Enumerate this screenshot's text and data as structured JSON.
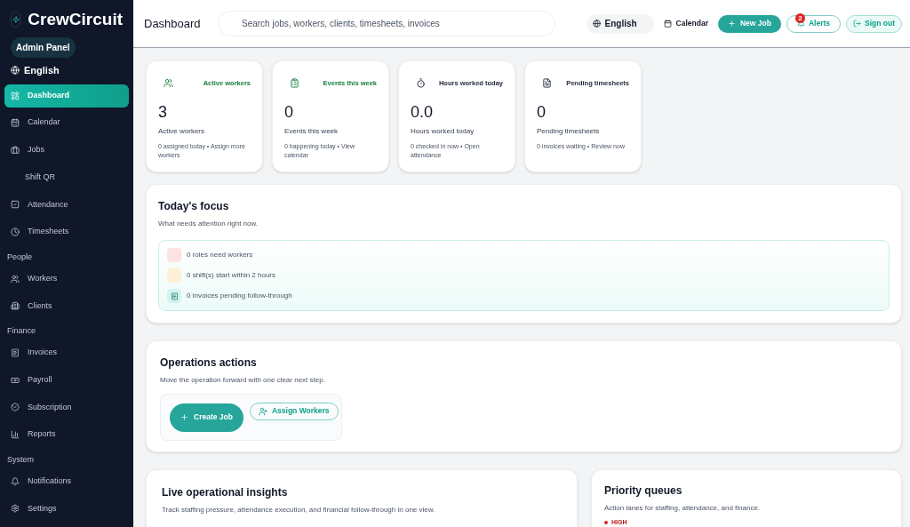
{
  "brand": {
    "name": "CrewCircuit",
    "badge": "Admin Panel",
    "language": "English"
  },
  "sidebar": {
    "sections": [
      {
        "items": [
          {
            "label": "Dashboard",
            "selected": true,
            "kind": "icon"
          },
          {
            "label": "Calendar",
            "selected": false,
            "kind": "icon"
          },
          {
            "label": "Jobs",
            "selected": false,
            "kind": "icon"
          },
          {
            "label": "Shift QR",
            "selected": false,
            "kind": "sub"
          },
          {
            "label": "Attendance",
            "selected": false,
            "kind": "icon"
          },
          {
            "label": "Timesheets",
            "selected": false,
            "kind": "icon"
          }
        ]
      },
      {
        "title": "People",
        "items": [
          {
            "label": "Workers",
            "selected": false,
            "kind": "icon"
          },
          {
            "label": "Clients",
            "selected": false,
            "kind": "icon"
          }
        ]
      },
      {
        "title": "Finance",
        "items": [
          {
            "label": "Invoices",
            "selected": false,
            "kind": "icon"
          },
          {
            "label": "Payroll",
            "selected": false,
            "kind": "icon"
          },
          {
            "label": "Subscription",
            "selected": false,
            "kind": "icon"
          },
          {
            "label": "Reports",
            "selected": false,
            "kind": "icon"
          }
        ]
      },
      {
        "title": "System",
        "items": [
          {
            "label": "Notifications",
            "selected": false,
            "kind": "icon"
          },
          {
            "label": "Settings",
            "selected": false,
            "kind": "icon"
          }
        ]
      }
    ]
  },
  "header": {
    "title": "Dashboard",
    "search": {
      "placeholder": "Search jobs, workers, clients, timesheets, invoices"
    },
    "language": "English",
    "calendar": "Calendar",
    "new_job": "New Job",
    "alerts": {
      "label": "Alerts",
      "count": "2"
    },
    "sign_out": "Sign out"
  },
  "stats": [
    {
      "heading": "Active workers",
      "color": "#15803d",
      "value": "3",
      "label": "Active workers",
      "note": "0 assigned today • Assign more workers"
    },
    {
      "heading": "Events this week",
      "color": "#15803d",
      "value": "0",
      "label": "Events this week",
      "note": "0 happening today • View calendar"
    },
    {
      "heading": "Hours worked today",
      "color": "#1f2937",
      "value": "0.0",
      "label": "Hours worked today",
      "note": "0 checked in now • Open attendance"
    },
    {
      "heading": "Pending timesheets",
      "color": "#1f2937",
      "value": "0",
      "label": "Pending timesheets",
      "note": "0 invoices waiting • Review now"
    }
  ],
  "focus": {
    "title": "Today's focus",
    "subtitle": "What needs attention right now.",
    "items": [
      {
        "text": "0 roles need workers",
        "color": "#fde2e2",
        "kind": "blank"
      },
      {
        "text": "0 shift(s) start within 2 hours",
        "color": "#fdf0d5",
        "kind": "blank"
      },
      {
        "text": "0 invoices pending follow-through",
        "color": "#d5f3ee",
        "kind": "icon"
      }
    ]
  },
  "operations": {
    "title": "Operations actions",
    "subtitle": "Move the operation forward with one clear next step.",
    "create": "Create Job",
    "assign": "Assign Workers"
  },
  "insights": {
    "title": "Live operational insights",
    "subtitle": "Track staffing pressure, attendance execution, and financial follow-through in one view."
  },
  "queues": {
    "title": "Priority queues",
    "subtitle": "Action lanes for staffing, attendance, and finance.",
    "first_lane": "HIGH"
  }
}
